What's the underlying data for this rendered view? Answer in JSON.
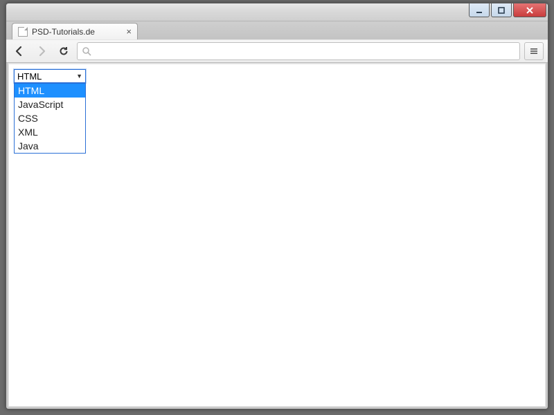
{
  "window": {
    "tab_title": "PSD-Tutorials.de"
  },
  "select": {
    "value": "HTML",
    "options": [
      "HTML",
      "JavaScript",
      "CSS",
      "XML",
      "Java"
    ],
    "selected_index": 0
  }
}
